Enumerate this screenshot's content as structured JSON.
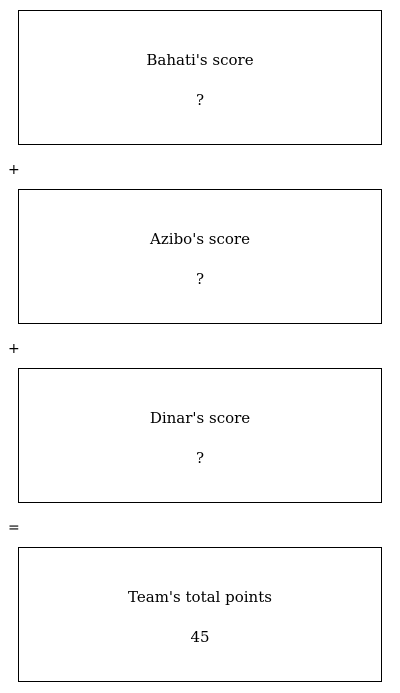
{
  "boxes": [
    {
      "label": "Bahati's score",
      "value": "?"
    },
    {
      "label": "Azibo's score",
      "value": "?"
    },
    {
      "label": "Dinar's score",
      "value": "?"
    },
    {
      "label": "Team's total points",
      "value": "45"
    }
  ],
  "operators": [
    "+",
    "+",
    "="
  ]
}
